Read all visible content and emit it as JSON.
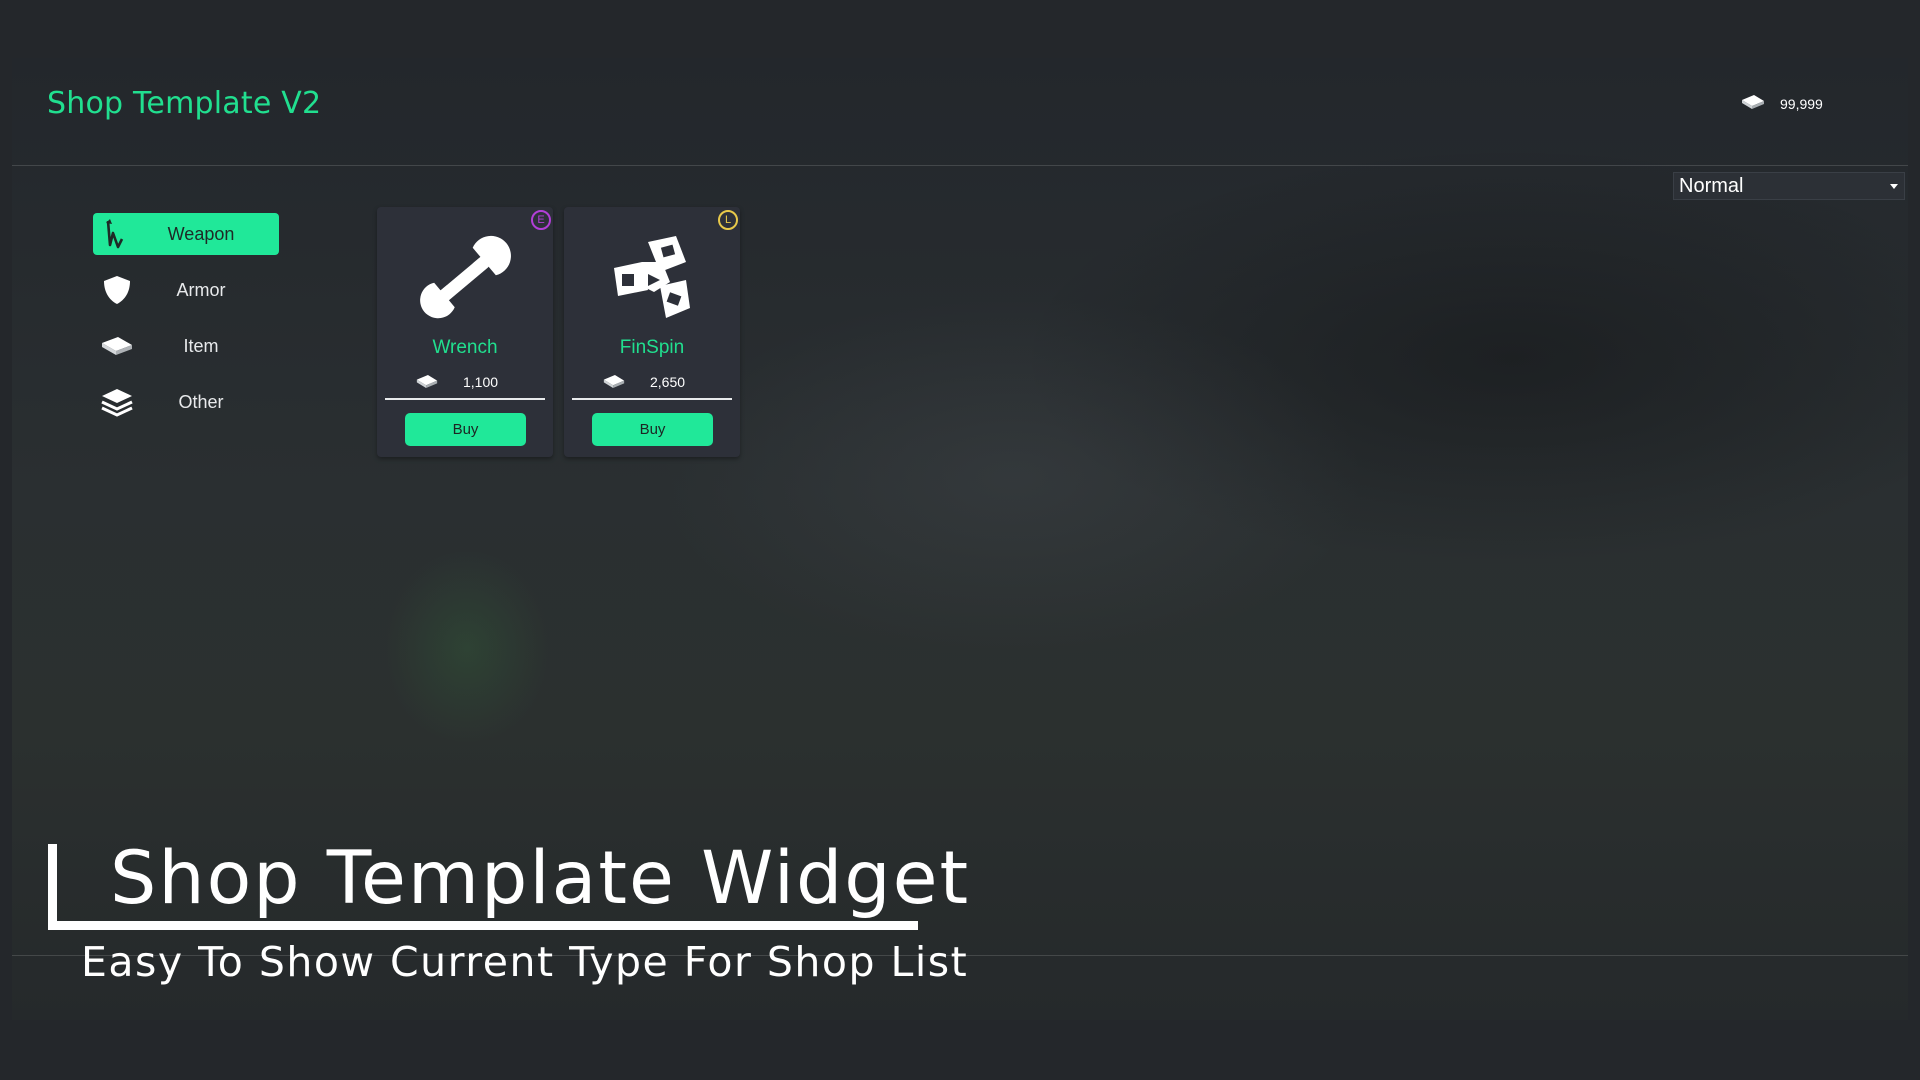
{
  "app": {
    "title": "Shop Template V2",
    "accent_color": "#20e899"
  },
  "currency": {
    "icon": "money-icon",
    "amount": "99,999"
  },
  "filter": {
    "selected": "Normal"
  },
  "categories": [
    {
      "label": "Weapon",
      "icon": "weapon-icon",
      "active": true
    },
    {
      "label": "Armor",
      "icon": "shield-icon",
      "active": false
    },
    {
      "label": "Item",
      "icon": "bar-icon",
      "active": false
    },
    {
      "label": "Other",
      "icon": "stack-icon",
      "active": false
    }
  ],
  "products": [
    {
      "name": "Wrench",
      "icon": "wrench-icon",
      "price": "1,100",
      "buy_label": "Buy",
      "rarity": "E",
      "rarity_color": "#b23fd8"
    },
    {
      "name": "FinSpin",
      "icon": "fidget-spinner-icon",
      "price": "2,650",
      "buy_label": "Buy",
      "rarity": "L",
      "rarity_color": "#e8c94a"
    }
  ],
  "banner": {
    "title": "Shop Template Widget",
    "subtitle": "Easy To Show Current Type For Shop List"
  }
}
